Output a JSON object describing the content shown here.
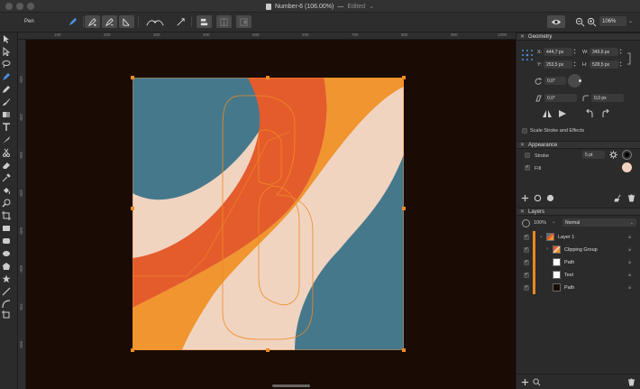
{
  "window": {
    "title": "Number-6 (106.00%)",
    "separator": "—",
    "status": "Edited",
    "status_chevron": "⌄"
  },
  "toolbar": {
    "tool_name": "Pen",
    "zoom_value": "106%"
  },
  "rulers": {
    "top": [
      "100",
      "200",
      "300",
      "400",
      "500",
      "600",
      "700",
      "800",
      "900",
      "1000"
    ],
    "left": [
      "100",
      "200",
      "300",
      "400",
      "500",
      "600",
      "700",
      "800",
      "900",
      "1000"
    ]
  },
  "geometry": {
    "title": "Geometry",
    "x_label": "X:",
    "x_value": "444,7 px",
    "y_label": "Y:",
    "y_value": "253,5 px",
    "w_label": "W:",
    "w_value": "349,6 px",
    "h_label": "H:",
    "h_value": "528,5 px",
    "rotation_value": "0,0°",
    "shear_value": "0,0°",
    "corner_value": "0,0 px",
    "scale_label": "Scale Stroke and Effects"
  },
  "appearance": {
    "title": "Appearance",
    "stroke_label": "Stroke",
    "stroke_value": "5 pt",
    "fill_label": "Fill",
    "fill_color": "#f2d2bf",
    "stroke_color": "#000000"
  },
  "layers": {
    "title": "Layers",
    "opacity": "100%",
    "blend_mode": "Normal",
    "items": [
      {
        "label": "Layer 1",
        "level": 0
      },
      {
        "label": "Clipping Group",
        "level": 1
      },
      {
        "label": "Path",
        "level": 2
      },
      {
        "label": "Text",
        "level": 2
      },
      {
        "label": "Path",
        "level": 2
      }
    ]
  },
  "colors": {
    "artwork_teal": "#46788c",
    "artwork_orange": "#e45c2c",
    "artwork_amber": "#f0952f",
    "artwork_cream": "#f0d4c0",
    "canvas_bg": "#1a0b05",
    "accent": "#f08a24"
  }
}
